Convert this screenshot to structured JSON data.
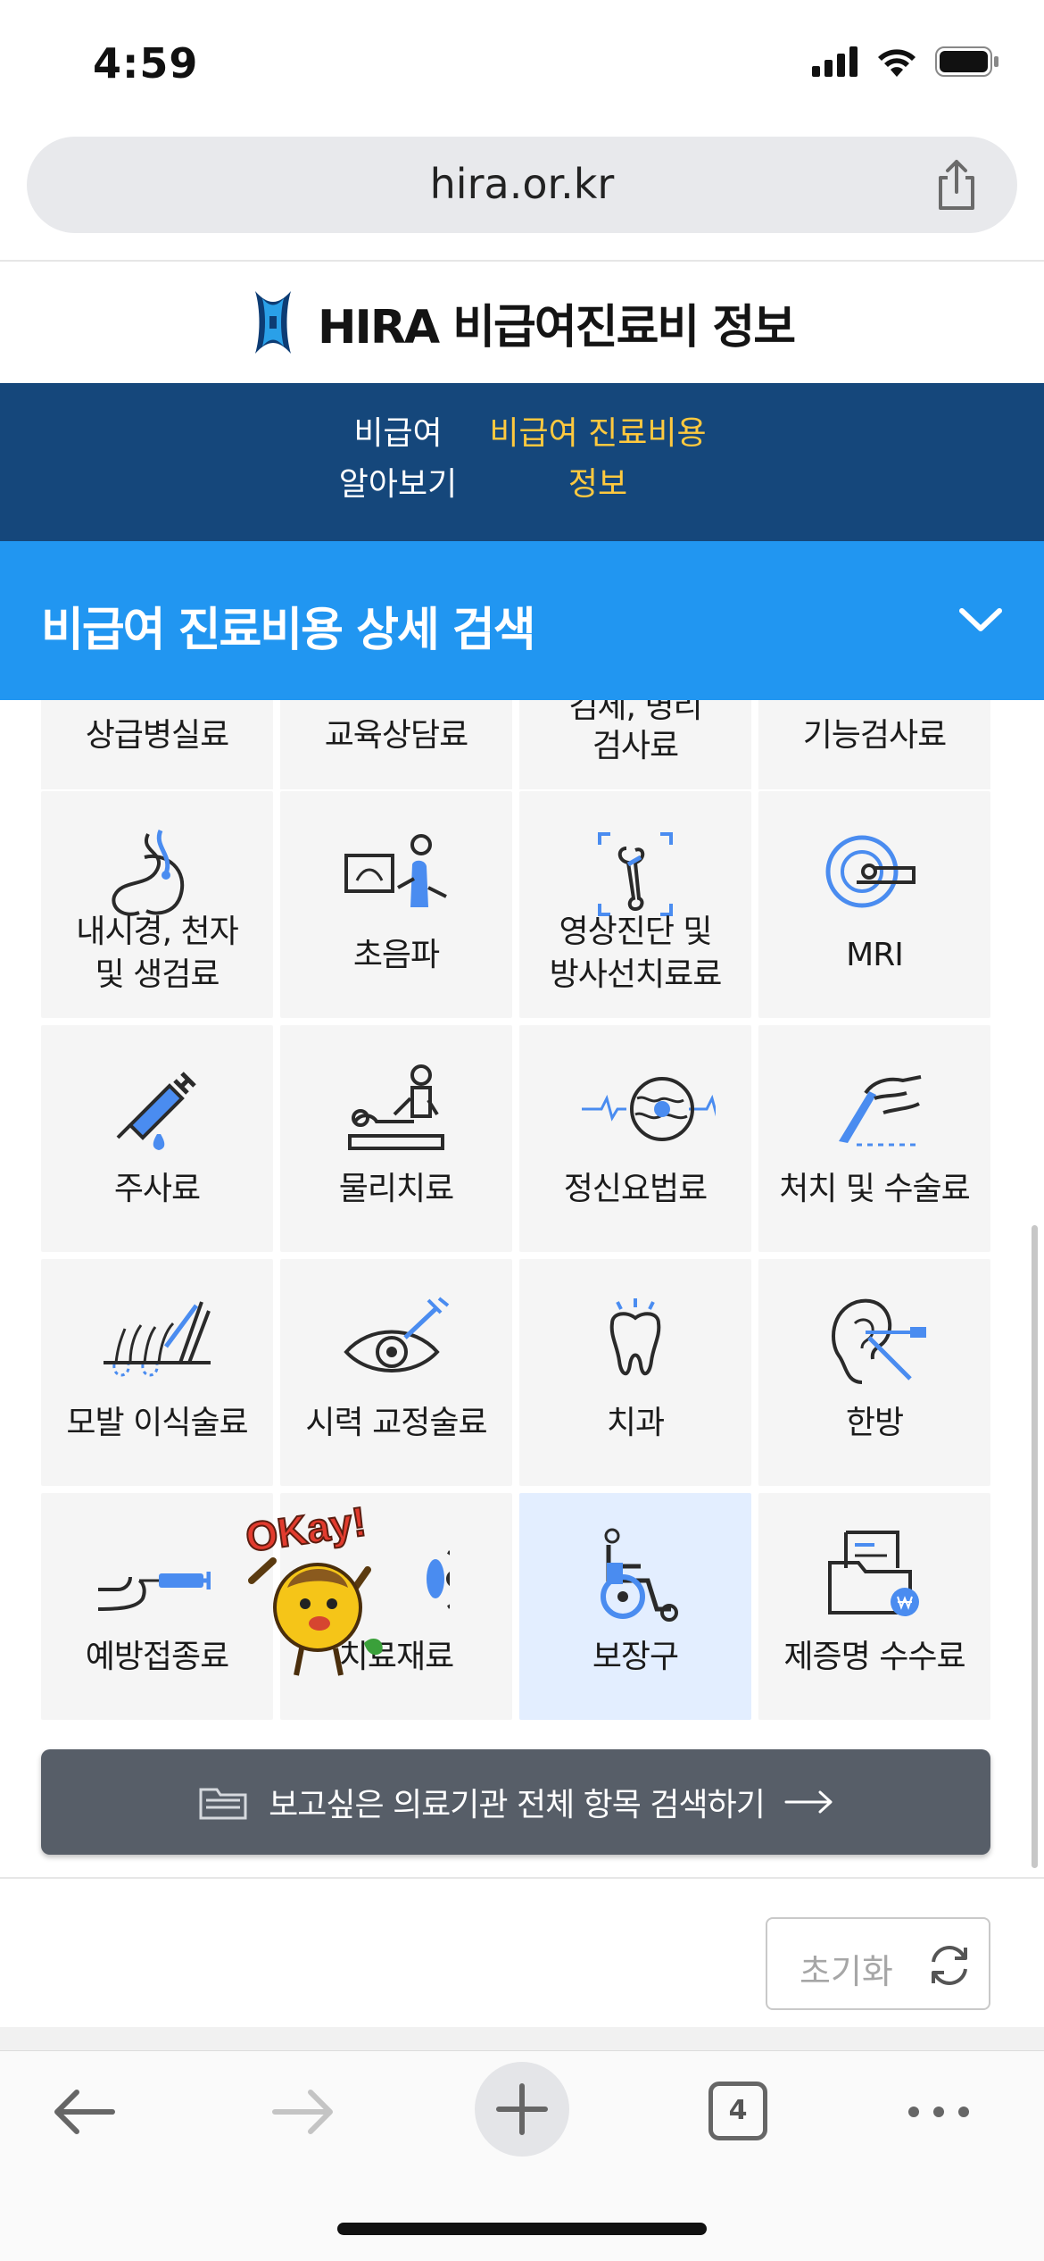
{
  "status_bar": {
    "time": "4:59"
  },
  "browser": {
    "url": "hira.or.kr",
    "tabs_count": "4"
  },
  "site": {
    "title": "HIRA 비급여진료비 정보"
  },
  "nav": [
    {
      "line1": "비급여",
      "line2": "알아보기",
      "active": false
    },
    {
      "line1": "비급여 진료비용",
      "line2": "정보",
      "active": true
    }
  ],
  "section": {
    "title": "비급여 진료비용 상세 검색"
  },
  "partial_row": [
    {
      "lines": [
        "상급병실료"
      ]
    },
    {
      "lines": [
        "교육상담료"
      ]
    },
    {
      "lines": [
        "검체, 병리",
        "검사료"
      ]
    },
    {
      "lines": [
        "기능검사료"
      ]
    }
  ],
  "categories": [
    {
      "lines": [
        "내시경, 천자",
        "및 생검료"
      ],
      "icon": "endoscope-icon"
    },
    {
      "lines": [
        "초음파"
      ],
      "icon": "ultrasound-icon"
    },
    {
      "lines": [
        "영상진단 및",
        "방사선치료료"
      ],
      "icon": "xray-bone-icon"
    },
    {
      "lines": [
        "MRI"
      ],
      "icon": "mri-scanner-icon"
    },
    {
      "lines": [
        "주사료"
      ],
      "icon": "syringe-icon"
    },
    {
      "lines": [
        "물리치료"
      ],
      "icon": "physical-therapy-icon"
    },
    {
      "lines": [
        "정신요법료"
      ],
      "icon": "brain-wave-icon"
    },
    {
      "lines": [
        "처치 및 수술료"
      ],
      "icon": "scalpel-hand-icon"
    },
    {
      "lines": [
        "모발 이식술료"
      ],
      "icon": "hair-transplant-icon"
    },
    {
      "lines": [
        "시력 교정술료"
      ],
      "icon": "eye-laser-icon"
    },
    {
      "lines": [
        "치과"
      ],
      "icon": "tooth-icon"
    },
    {
      "lines": [
        "한방"
      ],
      "icon": "ear-acupuncture-icon"
    },
    {
      "lines": [
        "예방접종료"
      ],
      "icon": "vaccine-arm-icon"
    },
    {
      "lines": [
        "치료재료"
      ],
      "icon": "lens-eye-icon"
    },
    {
      "lines": [
        "보장구"
      ],
      "icon": "wheelchair-icon",
      "selected": true
    },
    {
      "lines": [
        "제증명 수수료"
      ],
      "icon": "certificate-folder-icon"
    }
  ],
  "search_all": {
    "label": "보고싶은 의료기관 전체 항목 검색하기"
  },
  "reset": {
    "label": "초기화"
  },
  "sticker": {
    "text": "OKay!"
  },
  "colors": {
    "nav_bg": "#15477b",
    "accent_blue": "#2196f1",
    "nav_active": "#ffc93f",
    "icon_blue": "#4a8cf0"
  }
}
